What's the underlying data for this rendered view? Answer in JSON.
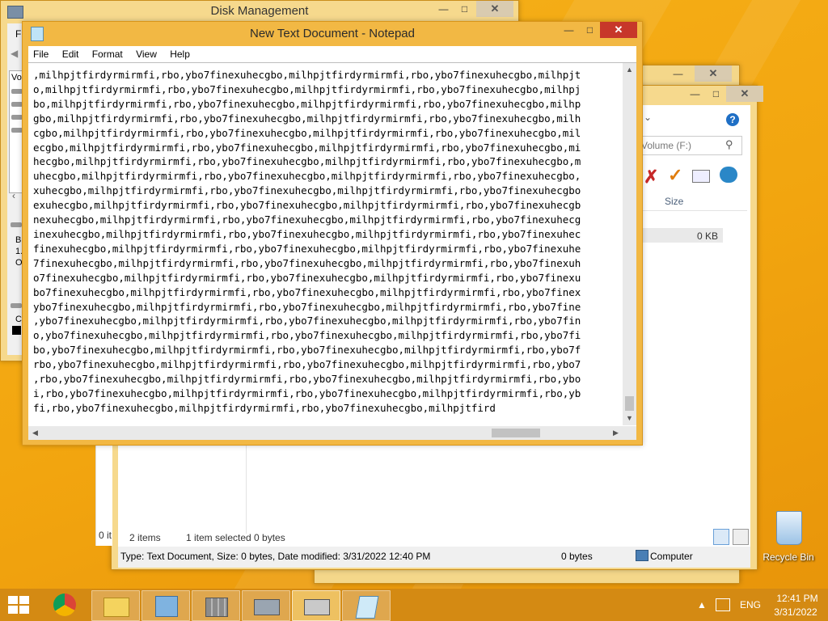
{
  "disk_management": {
    "title": "Disk Management",
    "menu_fragment": "Fi",
    "left_labels": [
      "Vo",
      "B",
      "1.",
      "O",
      "C"
    ]
  },
  "explorer": {
    "search_placeholder": "Volume (F:)",
    "column_size": "Size",
    "file_size": "0 KB",
    "status_items": "2 items",
    "status_selected": "1 item selected  0 bytes",
    "details_bar": "Type: Text Document, Size: 0 bytes, Date modified: 3/31/2022 12:40 PM",
    "details_size": "0 bytes",
    "details_location": "Computer",
    "back_status": "0 it"
  },
  "notepad": {
    "title": "New Text Document - Notepad",
    "menu": [
      "File",
      "Edit",
      "Format",
      "View",
      "Help"
    ],
    "lines": [
      ",milhpjtfirdyrmirmfi,rbo,ybo7finexuhecgbo,milhpjtfirdyrmirmfi,rbo,ybo7finexuhecgbo,milhpjt",
      "o,milhpjtfirdyrmirmfi,rbo,ybo7finexuhecgbo,milhpjtfirdyrmirmfi,rbo,ybo7finexuhecgbo,milhpj",
      "bo,milhpjtfirdyrmirmfi,rbo,ybo7finexuhecgbo,milhpjtfirdyrmirmfi,rbo,ybo7finexuhecgbo,milhp",
      "gbo,milhpjtfirdyrmirmfi,rbo,ybo7finexuhecgbo,milhpjtfirdyrmirmfi,rbo,ybo7finexuhecgbo,milh",
      "cgbo,milhpjtfirdyrmirmfi,rbo,ybo7finexuhecgbo,milhpjtfirdyrmirmfi,rbo,ybo7finexuhecgbo,mil",
      "ecgbo,milhpjtfirdyrmirmfi,rbo,ybo7finexuhecgbo,milhpjtfirdyrmirmfi,rbo,ybo7finexuhecgbo,mi",
      "hecgbo,milhpjtfirdyrmirmfi,rbo,ybo7finexuhecgbo,milhpjtfirdyrmirmfi,rbo,ybo7finexuhecgbo,m",
      "uhecgbo,milhpjtfirdyrmirmfi,rbo,ybo7finexuhecgbo,milhpjtfirdyrmirmfi,rbo,ybo7finexuhecgbo,",
      "xuhecgbo,milhpjtfirdyrmirmfi,rbo,ybo7finexuhecgbo,milhpjtfirdyrmirmfi,rbo,ybo7finexuhecgbo",
      "exuhecgbo,milhpjtfirdyrmirmfi,rbo,ybo7finexuhecgbo,milhpjtfirdyrmirmfi,rbo,ybo7finexuhecgb",
      "nexuhecgbo,milhpjtfirdyrmirmfi,rbo,ybo7finexuhecgbo,milhpjtfirdyrmirmfi,rbo,ybo7finexuhecg",
      "inexuhecgbo,milhpjtfirdyrmirmfi,rbo,ybo7finexuhecgbo,milhpjtfirdyrmirmfi,rbo,ybo7finexuhec",
      "finexuhecgbo,milhpjtfirdyrmirmfi,rbo,ybo7finexuhecgbo,milhpjtfirdyrmirmfi,rbo,ybo7finexuhe",
      "7finexuhecgbo,milhpjtfirdyrmirmfi,rbo,ybo7finexuhecgbo,milhpjtfirdyrmirmfi,rbo,ybo7finexuh",
      "o7finexuhecgbo,milhpjtfirdyrmirmfi,rbo,ybo7finexuhecgbo,milhpjtfirdyrmirmfi,rbo,ybo7finexu",
      "bo7finexuhecgbo,milhpjtfirdyrmirmfi,rbo,ybo7finexuhecgbo,milhpjtfirdyrmirmfi,rbo,ybo7finex",
      "ybo7finexuhecgbo,milhpjtfirdyrmirmfi,rbo,ybo7finexuhecgbo,milhpjtfirdyrmirmfi,rbo,ybo7fine",
      ",ybo7finexuhecgbo,milhpjtfirdyrmirmfi,rbo,ybo7finexuhecgbo,milhpjtfirdyrmirmfi,rbo,ybo7fin",
      "o,ybo7finexuhecgbo,milhpjtfirdyrmirmfi,rbo,ybo7finexuhecgbo,milhpjtfirdyrmirmfi,rbo,ybo7fi",
      "bo,ybo7finexuhecgbo,milhpjtfirdyrmirmfi,rbo,ybo7finexuhecgbo,milhpjtfirdyrmirmfi,rbo,ybo7f",
      "rbo,ybo7finexuhecgbo,milhpjtfirdyrmirmfi,rbo,ybo7finexuhecgbo,milhpjtfirdyrmirmfi,rbo,ybo7",
      ",rbo,ybo7finexuhecgbo,milhpjtfirdyrmirmfi,rbo,ybo7finexuhecgbo,milhpjtfirdyrmirmfi,rbo,ybo",
      "i,rbo,ybo7finexuhecgbo,milhpjtfirdyrmirmfi,rbo,ybo7finexuhecgbo,milhpjtfirdyrmirmfi,rbo,yb",
      "fi,rbo,ybo7finexuhecgbo,milhpjtfirdyrmirmfi,rbo,ybo7finexuhecgbo,milhpjtfird"
    ]
  },
  "desktop": {
    "recycle_bin_label": "Recycle Bin"
  },
  "taskbar": {
    "language": "ENG",
    "time": "12:41 PM",
    "date": "3/31/2022"
  }
}
